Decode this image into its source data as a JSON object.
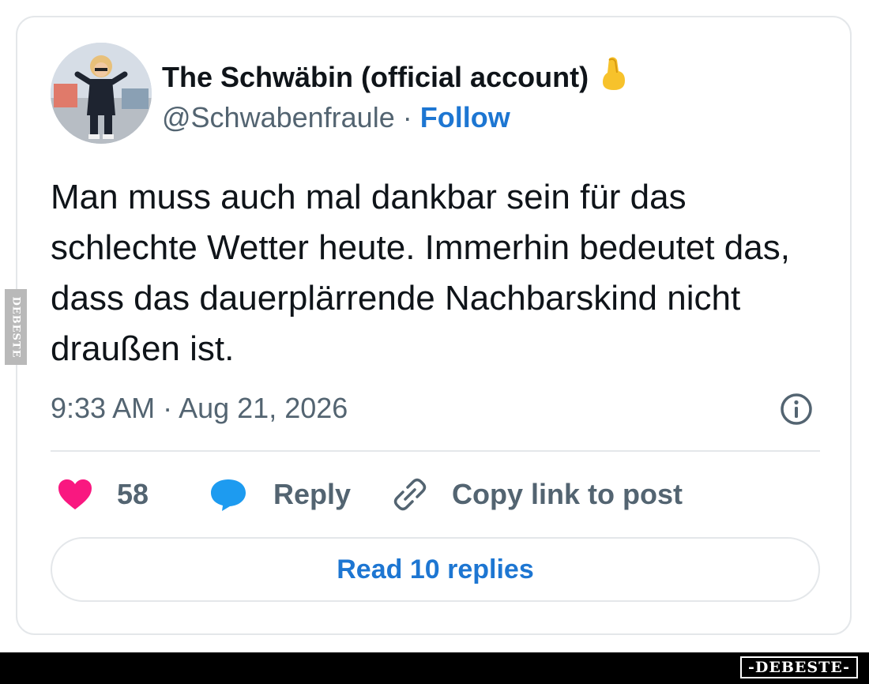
{
  "tweet": {
    "display_name": "The Schwäbin (official account)",
    "name_emoji": "pinched-fingers-emoji",
    "handle": "@Schwabenfraule",
    "separator": " · ",
    "follow_label": "Follow",
    "text": "Man muss auch mal dankbar sein für das schlechte Wetter heute. Immerhin bedeutet das, dass das dauerplärrende Nachbarskind nicht draußen ist.",
    "timestamp": "9:33 AM · Aug 21, 2026"
  },
  "actions": {
    "like_count": "58",
    "reply_label": "Reply",
    "copy_label": "Copy link to post"
  },
  "read_replies_label": "Read 10 replies",
  "watermark": {
    "side": "DEBESTE",
    "footer": "-DEBESTE-"
  },
  "colors": {
    "heart": "#f91880",
    "reply_bubble": "#1d9bf0",
    "link_blue": "#1d76d2",
    "muted": "#536471"
  },
  "icons": {
    "info": "info-icon",
    "heart": "heart-icon",
    "reply": "reply-bubble-icon",
    "link": "link-icon"
  }
}
